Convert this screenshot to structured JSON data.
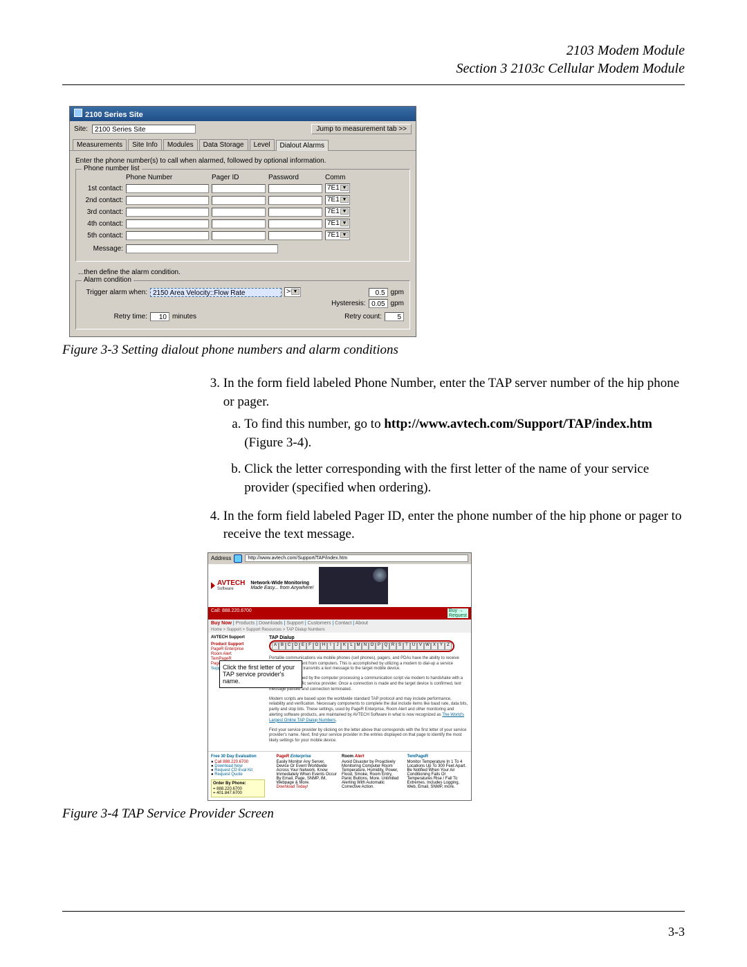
{
  "header": {
    "line1": "2103 Modem Module",
    "line2": "Section 3  2103c Cellular Modem Module"
  },
  "fig1_caption": "Figure 3-3  Setting dialout phone numbers and alarm conditions",
  "fig2_caption": "Figure 3-4  TAP Service Provider Screen",
  "steps": {
    "s3": "In the form field labeled Phone Number, enter the TAP server number of the hip phone or pager.",
    "s3a_pre": "To find this number, go to",
    "s3a_url": "http://www.avtech.com/Support/TAP/index.htm",
    "s3a_post": "(Figure 3-4).",
    "s3b": "Click the letter corresponding with the first letter of the name of your service provider (specified when ordering).",
    "s4": "In the form field labeled Pager ID, enter the phone number of the hip phone or pager to receive the text message."
  },
  "page_number": "3-3",
  "app": {
    "title": "2100 Series Site",
    "site_label": "Site:",
    "site_value": "2100 Series Site",
    "jump": "Jump to measurement tab >>",
    "tabs": [
      "Measurements",
      "Site Info",
      "Modules",
      "Data Storage",
      "Level",
      "Dialout Alarms"
    ],
    "active_tab": "Dialout Alarms",
    "instr": "Enter the phone number(s) to call when alarmed, followed by optional information.",
    "group_phones": "Phone number list",
    "cols": {
      "phone": "Phone Number",
      "pager": "Pager ID",
      "password": "Password",
      "comm": "Comm"
    },
    "rows": [
      {
        "lbl": "1st contact:",
        "comm": "7E1"
      },
      {
        "lbl": "2nd contact:",
        "comm": "7E1"
      },
      {
        "lbl": "3rd contact:",
        "comm": "7E1"
      },
      {
        "lbl": "4th contact:",
        "comm": "7E1"
      },
      {
        "lbl": "5th contact:",
        "comm": "7E1"
      }
    ],
    "message_lbl": "Message:",
    "note": "...then define the alarm condition.",
    "group_alarm": "Alarm condition",
    "trigger_lbl": "Trigger alarm when:",
    "trigger_val": "2150 Area Velocity::Flow Rate",
    "op": ">=",
    "thresh": "0.5",
    "thresh_unit": "gpm",
    "hyst_lbl": "Hysteresis:",
    "hyst": "0.05",
    "hyst_unit": "gpm",
    "retry_time_lbl": "Retry time:",
    "retry_time": "10",
    "retry_time_unit": "minutes",
    "retry_count_lbl": "Retry count:",
    "retry_count": "5"
  },
  "web": {
    "addr_lbl": "Address",
    "url": "http://www.avtech.com/Support/TAP/index.htm",
    "logo": "AVTECH",
    "logo_sub": "Software",
    "tag1": "Network-Wide Monitoring",
    "tag2": "Made Easy... from Anywhere!",
    "buy_link": "Buy Now",
    "redbar_left": "Call: 888.220.6700",
    "nav_items": [
      "Products",
      "Downloads",
      "Support",
      "Customers",
      "Contact",
      "About"
    ],
    "crumb": "Home > Support > Support Resources > TAP Dialup Numbers",
    "side_head": "AVTECH Support",
    "side_sec": "Product Support",
    "side_links": [
      "PageR Enterprise",
      "Room Alert",
      "TemPageR",
      "Page Command",
      "Supp..."
    ],
    "content_title": "TAP Dialup",
    "az": [
      "A",
      "B",
      "C",
      "D",
      "E",
      "F",
      "G",
      "H",
      "I",
      "J",
      "K",
      "L",
      "M",
      "N",
      "O",
      "P",
      "Q",
      "R",
      "S",
      "T",
      "U",
      "V",
      "W",
      "X",
      "Y",
      "Z"
    ],
    "body1": "Portable communications via mobile phones (cell phones), pagers, and PDAs have the ability to receive short messages sent from computers. This is accomplished by utilizing a modem to dial-up a service provider who then transmits a text message to the target mobile device.",
    "body2": "This is accomplished by the computer processing a communication script via modem to handshake with a modem at a specific service provider. Once a connection is made and the target device is confirmed, text message passed and connection terminated.",
    "body3": "Modem scripts are based upon the worldwide standard TAP protocol and may include performance, reliability and verification. Necessary components to complete the dial include items like baud rate, data bits, parity and stop bits. These settings, used by PageR Enterprise, Room Alert and other monitoring and alerting software products, are maintained by AVTECH Software in what is now recognized as ",
    "body3_link": "The World's Largest Online TAP Dialup Numbers",
    "body4": "Find your service provider by clicking on the letter above that corresponds with the first letter of your service provider's name. Next, find your service provider in the entries displayed on that page to identify the most likely settings for your mobile device.",
    "callout": "Click the first letter of your TAP service provider's name.",
    "promo": {
      "free": "Free 30 Day Evaluation",
      "free_items": [
        "Call 888.220.6700",
        "Download Now",
        "Request CD Eval Kit",
        "Request Quote"
      ],
      "p1_title": "PageR Enterprise",
      "p1": "Easily Monitor Any Server, Device Or Event Worldwide Across Your Network. Know Immediately When Events Occur By Email, Page, SNMP, IM, Webpage & More.",
      "p1_link": "Download Today!",
      "p2_title": "Room Alert",
      "p2": "Avoid Disaster by Proactively Monitoring Computer Room Temperature, Humidity, Power, Flood, Smoke, Room Entry, Panic Buttons, More. Unlimited Alerting With Automatic Corrective Action.",
      "p3_title": "TemPageR",
      "p3": "Monitor Temperature In 1 To 4 Locations Up To 300 Feet Apart. Be Notified When Your Air Conditioning Fails Or Temperatures Rise / Fall To Extremes. Includes Logging, Web, Email, SNMP, more.",
      "order_title": "Order By Phone:",
      "order1": "= 888.220.6700",
      "order2": "= 401.847.6700"
    }
  }
}
